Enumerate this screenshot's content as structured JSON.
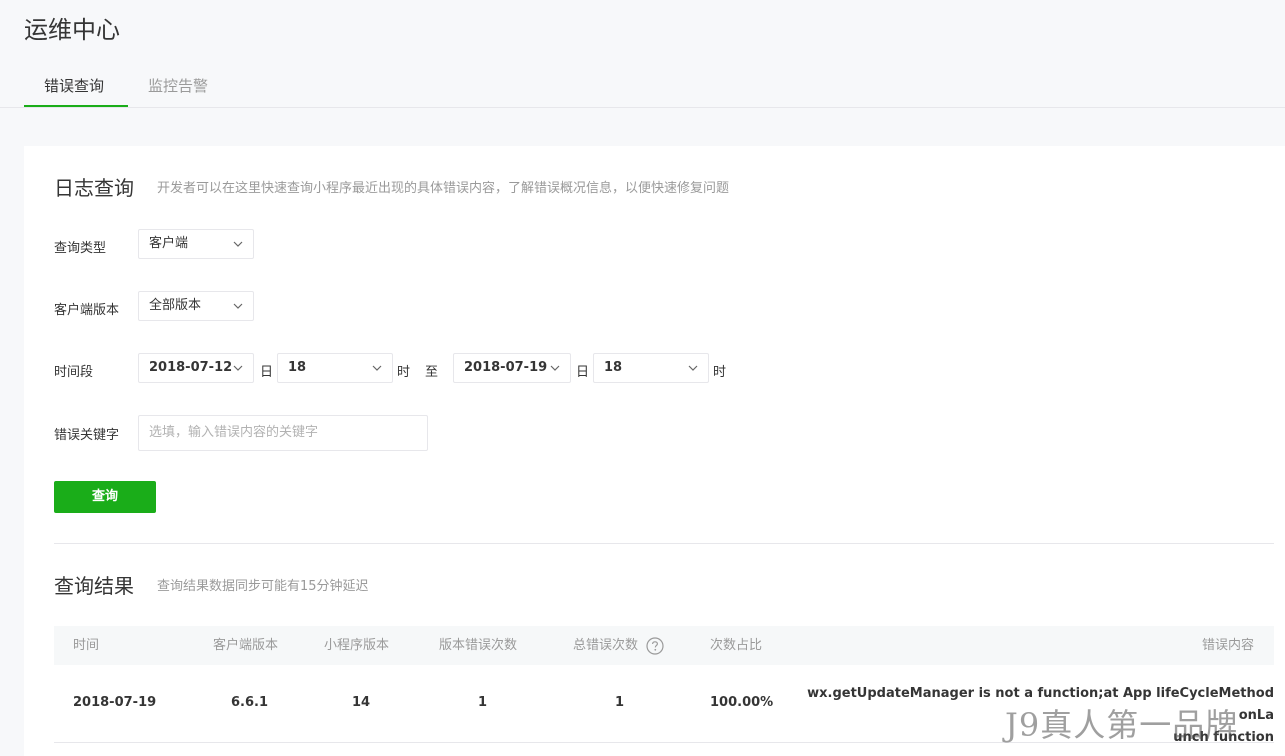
{
  "page": {
    "title": "运维中心"
  },
  "tabs": [
    {
      "label": "错误查询",
      "active": true
    },
    {
      "label": "监控告警",
      "active": false
    }
  ],
  "log_query": {
    "title": "日志查询",
    "description": "开发者可以在这里快速查询小程序最近出现的具体错误内容，了解错误概况信息，以便快速修复问题",
    "query_type": {
      "label": "查询类型",
      "value": "客户端"
    },
    "client_version": {
      "label": "客户端版本",
      "value": "全部版本"
    },
    "time_range": {
      "label": "时间段",
      "start_date": "2018-07-12",
      "start_day_unit": "日",
      "start_hour": "18",
      "start_hour_unit": "时",
      "to": "至",
      "end_date": "2018-07-19",
      "end_day_unit": "日",
      "end_hour": "18",
      "end_hour_unit": "时"
    },
    "keyword": {
      "label": "错误关键字",
      "placeholder": "选填，输入错误内容的关键字"
    },
    "query_button": "查询"
  },
  "results": {
    "title": "查询结果",
    "description": "查询结果数据同步可能有15分钟延迟",
    "columns": [
      "时间",
      "客户端版本",
      "小程序版本",
      "版本错误次数",
      "总错误次数",
      "次数占比",
      "错误内容"
    ],
    "rows": [
      {
        "time": "2018-07-19",
        "client_version": "6.6.1",
        "app_version": "14",
        "version_errors": "1",
        "total_errors": "1",
        "ratio": "100.00%",
        "content_line1": "wx.getUpdateManager is not a function;at App lifeCycleMethod onLa",
        "content_line2": "unch function"
      }
    ]
  },
  "watermark": "J9真人第一品牌",
  "colors": {
    "accent": "#1aad19",
    "muted": "#9a9a9a",
    "text": "#353535"
  },
  "icons": {
    "dropdown": "chevron-down-icon",
    "help": "question-circle-icon"
  }
}
